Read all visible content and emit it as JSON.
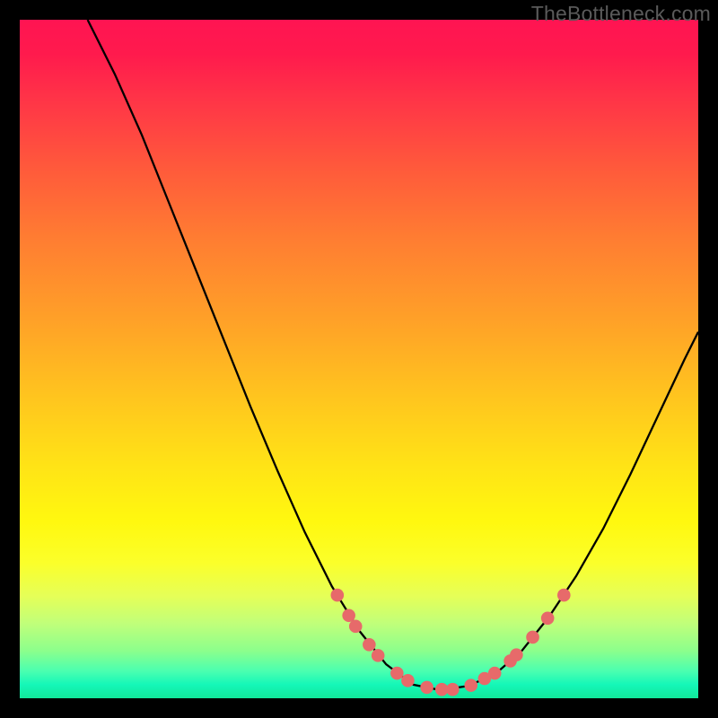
{
  "watermark": "TheBottleneck.com",
  "chart_data": {
    "type": "line",
    "title": "",
    "xlabel": "",
    "ylabel": "",
    "xlim": [
      0,
      100
    ],
    "ylim": [
      0,
      100
    ],
    "curve": [
      {
        "x": 10.0,
        "y": 100.0
      },
      {
        "x": 14.0,
        "y": 92.0
      },
      {
        "x": 18.0,
        "y": 83.0
      },
      {
        "x": 22.0,
        "y": 73.0
      },
      {
        "x": 26.0,
        "y": 63.0
      },
      {
        "x": 30.0,
        "y": 53.0
      },
      {
        "x": 34.0,
        "y": 43.0
      },
      {
        "x": 38.0,
        "y": 33.5
      },
      {
        "x": 42.0,
        "y": 24.5
      },
      {
        "x": 46.0,
        "y": 16.5
      },
      {
        "x": 50.0,
        "y": 10.0
      },
      {
        "x": 54.0,
        "y": 5.0
      },
      {
        "x": 58.0,
        "y": 2.0
      },
      {
        "x": 62.0,
        "y": 1.2
      },
      {
        "x": 66.0,
        "y": 1.8
      },
      {
        "x": 70.0,
        "y": 3.5
      },
      {
        "x": 74.0,
        "y": 7.0
      },
      {
        "x": 78.0,
        "y": 12.0
      },
      {
        "x": 82.0,
        "y": 18.0
      },
      {
        "x": 86.0,
        "y": 25.0
      },
      {
        "x": 90.0,
        "y": 33.0
      },
      {
        "x": 94.0,
        "y": 41.5
      },
      {
        "x": 98.0,
        "y": 50.0
      },
      {
        "x": 100.0,
        "y": 54.0
      }
    ],
    "markers": [
      {
        "x": 46.8,
        "y": 15.2
      },
      {
        "x": 48.5,
        "y": 12.2
      },
      {
        "x": 49.5,
        "y": 10.6
      },
      {
        "x": 51.5,
        "y": 7.9
      },
      {
        "x": 52.8,
        "y": 6.3
      },
      {
        "x": 55.6,
        "y": 3.7
      },
      {
        "x": 57.2,
        "y": 2.6
      },
      {
        "x": 60.0,
        "y": 1.6
      },
      {
        "x": 62.2,
        "y": 1.3
      },
      {
        "x": 63.8,
        "y": 1.3
      },
      {
        "x": 66.5,
        "y": 1.9
      },
      {
        "x": 68.5,
        "y": 2.9
      },
      {
        "x": 70.0,
        "y": 3.7
      },
      {
        "x": 72.3,
        "y": 5.5
      },
      {
        "x": 73.2,
        "y": 6.4
      },
      {
        "x": 75.6,
        "y": 9.0
      },
      {
        "x": 77.8,
        "y": 11.8
      },
      {
        "x": 80.2,
        "y": 15.2
      }
    ],
    "marker_color": "#e76a6a",
    "line_color": "#000000"
  }
}
